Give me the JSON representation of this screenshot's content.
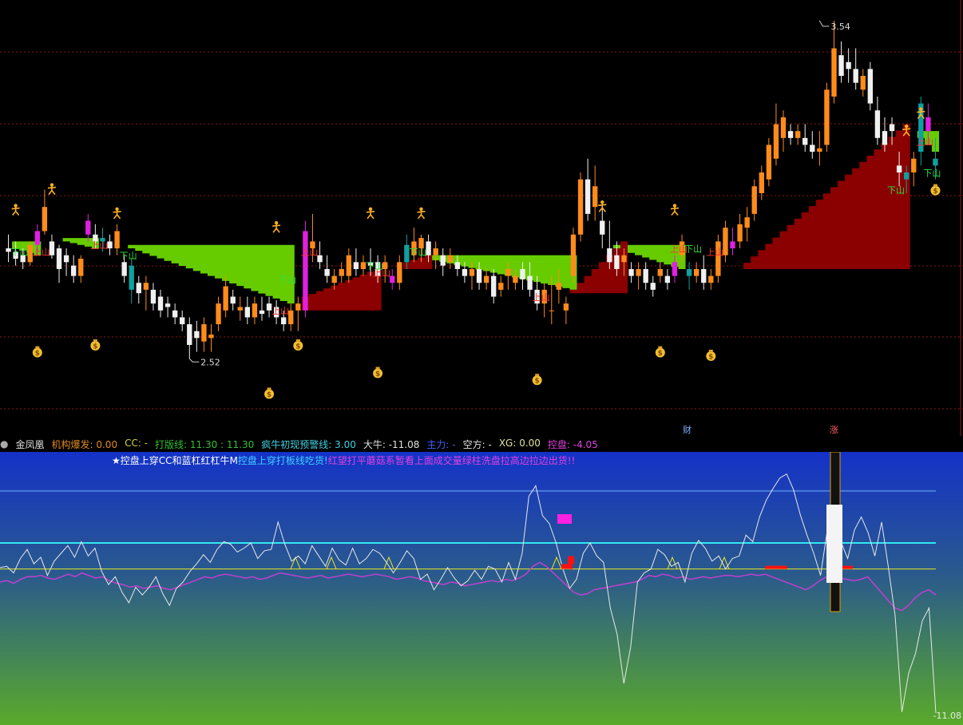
{
  "chart_data": [
    {
      "type": "candlestick",
      "panel": "main",
      "price_range": [
        2.35,
        3.6
      ],
      "annotations": {
        "high_label": "3.54",
        "low_label": "2.52"
      },
      "candles": [
        [
          2.88,
          2.92,
          2.84,
          2.87
        ],
        [
          2.87,
          2.9,
          2.83,
          2.85
        ],
        [
          2.86,
          2.88,
          2.82,
          2.84
        ],
        [
          2.84,
          2.9,
          2.83,
          2.89
        ],
        [
          2.89,
          2.95,
          2.86,
          2.93
        ],
        [
          2.93,
          3.05,
          2.92,
          3.0
        ],
        [
          2.9,
          2.92,
          2.85,
          2.86
        ],
        [
          2.88,
          2.89,
          2.78,
          2.82
        ],
        [
          2.86,
          2.88,
          2.8,
          2.84
        ],
        [
          2.83,
          2.86,
          2.78,
          2.8
        ],
        [
          2.8,
          2.86,
          2.78,
          2.85
        ],
        [
          2.92,
          2.98,
          2.9,
          2.96
        ],
        [
          2.92,
          2.95,
          2.88,
          2.9
        ],
        [
          2.9,
          2.94,
          2.87,
          2.91
        ],
        [
          2.9,
          2.92,
          2.86,
          2.88
        ],
        [
          2.88,
          2.95,
          2.86,
          2.93
        ],
        [
          2.84,
          2.86,
          2.78,
          2.8
        ],
        [
          2.83,
          2.85,
          2.72,
          2.76
        ],
        [
          2.78,
          2.8,
          2.72,
          2.75
        ],
        [
          2.76,
          2.8,
          2.7,
          2.78
        ],
        [
          2.76,
          2.78,
          2.7,
          2.72
        ],
        [
          2.74,
          2.76,
          2.68,
          2.7
        ],
        [
          2.72,
          2.74,
          2.68,
          2.71
        ],
        [
          2.7,
          2.72,
          2.66,
          2.68
        ],
        [
          2.68,
          2.7,
          2.64,
          2.66
        ],
        [
          2.66,
          2.68,
          2.56,
          2.6
        ],
        [
          2.64,
          2.67,
          2.58,
          2.62
        ],
        [
          2.61,
          2.68,
          2.58,
          2.66
        ],
        [
          2.62,
          2.66,
          2.58,
          2.63
        ],
        [
          2.66,
          2.74,
          2.64,
          2.72
        ],
        [
          2.7,
          2.8,
          2.68,
          2.77
        ],
        [
          2.74,
          2.76,
          2.7,
          2.72
        ],
        [
          2.7,
          2.74,
          2.67,
          2.71
        ],
        [
          2.71,
          2.74,
          2.66,
          2.68
        ],
        [
          2.68,
          2.74,
          2.66,
          2.72
        ],
        [
          2.7,
          2.74,
          2.67,
          2.69
        ],
        [
          2.72,
          2.74,
          2.68,
          2.7
        ],
        [
          2.71,
          2.73,
          2.66,
          2.68
        ],
        [
          2.68,
          2.7,
          2.64,
          2.66
        ],
        [
          2.66,
          2.72,
          2.64,
          2.7
        ],
        [
          2.7,
          2.74,
          2.64,
          2.72
        ],
        [
          2.7,
          2.96,
          2.68,
          2.93
        ],
        [
          2.88,
          2.98,
          2.84,
          2.9
        ],
        [
          2.86,
          2.9,
          2.82,
          2.84
        ],
        [
          2.82,
          2.86,
          2.78,
          2.8
        ],
        [
          2.78,
          2.82,
          2.76,
          2.8
        ],
        [
          2.8,
          2.84,
          2.78,
          2.82
        ],
        [
          2.8,
          2.88,
          2.78,
          2.86
        ],
        [
          2.84,
          2.88,
          2.8,
          2.82
        ],
        [
          2.82,
          2.86,
          2.8,
          2.84
        ],
        [
          2.84,
          2.88,
          2.8,
          2.83
        ],
        [
          2.84,
          2.86,
          2.78,
          2.8
        ],
        [
          2.82,
          2.86,
          2.78,
          2.84
        ],
        [
          2.8,
          2.82,
          2.76,
          2.78
        ],
        [
          2.78,
          2.86,
          2.76,
          2.84
        ],
        [
          2.84,
          2.92,
          2.82,
          2.89
        ],
        [
          2.86,
          2.94,
          2.84,
          2.9
        ],
        [
          2.88,
          2.92,
          2.84,
          2.91
        ],
        [
          2.9,
          2.92,
          2.84,
          2.86
        ],
        [
          2.86,
          2.9,
          2.82,
          2.88
        ],
        [
          2.86,
          2.88,
          2.8,
          2.83
        ],
        [
          2.84,
          2.88,
          2.82,
          2.86
        ],
        [
          2.84,
          2.86,
          2.8,
          2.82
        ],
        [
          2.82,
          2.84,
          2.78,
          2.8
        ],
        [
          2.8,
          2.84,
          2.76,
          2.82
        ],
        [
          2.82,
          2.84,
          2.76,
          2.78
        ],
        [
          2.78,
          2.82,
          2.76,
          2.8
        ],
        [
          2.8,
          2.82,
          2.72,
          2.74
        ],
        [
          2.76,
          2.8,
          2.74,
          2.78
        ],
        [
          2.8,
          2.84,
          2.76,
          2.82
        ],
        [
          2.78,
          2.82,
          2.76,
          2.8
        ],
        [
          2.82,
          2.84,
          2.76,
          2.79
        ],
        [
          2.8,
          2.84,
          2.74,
          2.76
        ],
        [
          2.76,
          2.8,
          2.7,
          2.72
        ],
        [
          2.72,
          2.78,
          2.68,
          2.76
        ],
        [
          2.7,
          2.8,
          2.66,
          2.7
        ],
        [
          2.76,
          2.82,
          2.72,
          2.78
        ],
        [
          2.7,
          2.74,
          2.66,
          2.72
        ],
        [
          2.8,
          2.94,
          2.78,
          2.92
        ],
        [
          2.92,
          3.1,
          2.9,
          3.08
        ],
        [
          3.08,
          3.14,
          2.96,
          2.98
        ],
        [
          3.0,
          3.12,
          2.96,
          3.06
        ],
        [
          2.96,
          3.0,
          2.88,
          2.92
        ],
        [
          2.88,
          2.96,
          2.82,
          2.84
        ],
        [
          2.86,
          2.9,
          2.8,
          2.82
        ],
        [
          2.84,
          2.88,
          2.8,
          2.86
        ],
        [
          2.82,
          2.84,
          2.78,
          2.8
        ],
        [
          2.8,
          2.84,
          2.76,
          2.82
        ],
        [
          2.82,
          2.84,
          2.76,
          2.78
        ],
        [
          2.78,
          2.8,
          2.74,
          2.76
        ],
        [
          2.8,
          2.84,
          2.78,
          2.82
        ],
        [
          2.8,
          2.82,
          2.76,
          2.78
        ],
        [
          2.8,
          2.86,
          2.78,
          2.84
        ],
        [
          2.86,
          2.92,
          2.84,
          2.9
        ],
        [
          2.82,
          2.84,
          2.76,
          2.8
        ],
        [
          2.8,
          2.84,
          2.78,
          2.82
        ],
        [
          2.82,
          2.86,
          2.76,
          2.78
        ],
        [
          2.78,
          2.82,
          2.76,
          2.8
        ],
        [
          2.8,
          2.92,
          2.78,
          2.9
        ],
        [
          2.86,
          2.96,
          2.84,
          2.94
        ],
        [
          2.88,
          2.94,
          2.86,
          2.9
        ],
        [
          2.9,
          2.98,
          2.88,
          2.95
        ],
        [
          2.94,
          3.0,
          2.9,
          2.97
        ],
        [
          2.98,
          3.08,
          2.96,
          3.06
        ],
        [
          3.04,
          3.12,
          3.02,
          3.1
        ],
        [
          3.08,
          3.2,
          3.06,
          3.18
        ],
        [
          3.14,
          3.3,
          3.12,
          3.24
        ],
        [
          3.2,
          3.28,
          3.16,
          3.26
        ],
        [
          3.22,
          3.24,
          3.18,
          3.2
        ],
        [
          3.2,
          3.24,
          3.18,
          3.22
        ],
        [
          3.2,
          3.24,
          3.16,
          3.18
        ],
        [
          3.18,
          3.22,
          3.14,
          3.16
        ],
        [
          3.16,
          3.22,
          3.12,
          3.17
        ],
        [
          3.18,
          3.36,
          3.16,
          3.34
        ],
        [
          3.32,
          3.54,
          3.3,
          3.46
        ],
        [
          3.44,
          3.48,
          3.36,
          3.38
        ],
        [
          3.42,
          3.46,
          3.36,
          3.4
        ],
        [
          3.4,
          3.46,
          3.34,
          3.36
        ],
        [
          3.34,
          3.4,
          3.32,
          3.38
        ],
        [
          3.4,
          3.42,
          3.28,
          3.3
        ],
        [
          3.28,
          3.32,
          3.18,
          3.2
        ],
        [
          3.22,
          3.26,
          3.16,
          3.18
        ],
        [
          3.24,
          3.26,
          3.18,
          3.22
        ],
        [
          3.12,
          3.16,
          3.06,
          3.1
        ],
        [
          3.08,
          3.12,
          3.04,
          3.1
        ],
        [
          3.1,
          3.16,
          3.06,
          3.14
        ],
        [
          3.16,
          3.32,
          3.12,
          3.3
        ],
        [
          3.22,
          3.3,
          3.18,
          3.26
        ],
        [
          3.14,
          3.2,
          3.08,
          3.12
        ]
      ]
    },
    {
      "type": "line",
      "panel": "indicator",
      "ylim": [
        -12,
        9
      ],
      "levels": [
        6,
        2,
        0
      ],
      "value_label": "-11.08",
      "series": [
        {
          "values": [
            0.1,
            0.2,
            -0.3,
            0.8,
            1.5,
            0.4,
            0.9,
            -0.5,
            0.6,
            1.2,
            1.8,
            0.9,
            2.1,
            1.0,
            1.6,
            -0.2,
            -1.2,
            -0.6,
            -1.8,
            -2.6,
            -1.4,
            -2.0,
            -1.4,
            -0.6,
            -1.9,
            -2.8,
            -1.5,
            -1.0,
            -0.2,
            0.4,
            1.1,
            0.5,
            1.5,
            2.1,
            1.9,
            1.3,
            1.6,
            2.0,
            0.8,
            1.4,
            1.5,
            3.6,
            1.9,
            0.6,
            1.0,
            0.4,
            1.8,
            1.0,
            0.2,
            1.6,
            0.7,
            0.3,
            1.6,
            0.4,
            0.8,
            1.5,
            1.2,
            0.5,
            -0.3,
            0.5,
            1.4,
            0.8,
            -0.8,
            -0.4,
            -1.6,
            -0.8,
            0.1,
            -0.7,
            -1.3,
            -0.9,
            -0.1,
            -0.8,
            0.2,
            0.0,
            -1.0,
            0.5,
            -0.8,
            1.2,
            5.6,
            6.4,
            4.1,
            3.5,
            2.0,
            0.0,
            -1.5,
            -0.8,
            1.2,
            2.0,
            1.0,
            0.5,
            -3.0,
            -5.0,
            -8.8,
            -6.0,
            -1.0,
            -0.3,
            0.0,
            1.5,
            1.1,
            0.2,
            0.5,
            -1.0,
            1.2,
            2.2,
            1.6,
            0.6,
            1.0,
            0.0,
            0.8,
            1.0,
            2.6,
            2.1,
            4.0,
            5.3,
            6.2,
            7.0,
            7.3,
            6.1,
            4.2,
            2.6,
            1.2,
            -0.5,
            3.0,
            3.7,
            2.1,
            0.8,
            3.0,
            4.0,
            2.8,
            1.0,
            3.6,
            0.1,
            -3.6,
            -11.0,
            -8.0,
            -6.5,
            -4.0,
            -3.0,
            -11.08
          ]
        },
        {
          "values": [
            -1.0,
            -0.9,
            -1.1,
            -0.8,
            -0.6,
            -0.6,
            -0.5,
            -0.7,
            -0.8,
            -0.6,
            -0.4,
            -0.6,
            -0.3,
            -0.5,
            -0.7,
            -0.6,
            -0.9,
            -1.1,
            -1.2,
            -1.4,
            -1.3,
            -1.5,
            -1.4,
            -1.3,
            -1.5,
            -1.6,
            -1.4,
            -1.2,
            -1.0,
            -0.8,
            -0.6,
            -0.7,
            -0.5,
            -0.4,
            -0.5,
            -0.6,
            -0.7,
            -0.6,
            -0.8,
            -0.7,
            -0.5,
            -0.3,
            -0.4,
            -0.5,
            -0.6,
            -0.7,
            -0.6,
            -0.5,
            -0.7,
            -0.6,
            -0.5,
            -0.4,
            -0.5,
            -0.6,
            -0.5,
            -0.4,
            -0.5,
            -0.6,
            -0.8,
            -0.7,
            -0.6,
            -0.7,
            -0.9,
            -1.0,
            -1.1,
            -1.2,
            -1.0,
            -1.1,
            -1.3,
            -1.2,
            -1.1,
            -1.0,
            -0.9,
            -1.0,
            -0.8,
            -0.9,
            -0.7,
            -0.4,
            0.2,
            0.5,
            0.2,
            -0.3,
            -0.8,
            -1.3,
            -1.8,
            -2.0,
            -1.9,
            -1.6,
            -1.5,
            -1.4,
            -1.3,
            -1.2,
            -1.1,
            -1.0,
            -0.8,
            -0.5,
            -0.6,
            -0.4,
            -0.5,
            -0.7,
            -0.6,
            -0.8,
            -0.7,
            -0.6,
            -0.7,
            -0.6,
            -0.5,
            -0.5,
            -0.6,
            -0.5,
            -0.4,
            -0.5,
            -0.4,
            -0.6,
            -0.8,
            -1.0,
            -1.2,
            -1.4,
            -1.6,
            -1.3,
            -0.9,
            -0.6,
            -0.8,
            -0.7,
            -0.8,
            -0.9,
            -0.8,
            -0.6,
            -1.2,
            -1.8,
            -2.4,
            -3.0,
            -3.2,
            -2.8,
            -2.2,
            -1.8,
            -1.6,
            -2.0
          ]
        }
      ]
    }
  ],
  "status": {
    "name": "金凤凰",
    "items": [
      {
        "label": "机构爆发:",
        "value": "0.00",
        "color": "#e08a20"
      },
      {
        "label": "CC:",
        "value": "-",
        "color": "#d0d040"
      },
      {
        "label": "打版线:",
        "value": "11.30",
        "value2": ": 11.30",
        "color": "#30c030"
      },
      {
        "label": "疯牛初现预警线:",
        "value": "3.00",
        "color": "#40d0e0"
      },
      {
        "label": "大牛:",
        "value": "-11.08",
        "color": "#e0e0e0"
      },
      {
        "label": "主力:",
        "value": "-",
        "color": "#4060ff"
      },
      {
        "label": "空方:",
        "value": "-",
        "color": "#e0e0e0"
      },
      {
        "label": "XG:",
        "value": "0.00",
        "color": "#e0e0a0"
      },
      {
        "label": "控盘:",
        "value": "-4.05",
        "color": "#e040e0"
      }
    ]
  },
  "signal_text": {
    "part1": "★控盘上穿CC和蓝杠红杠牛M",
    "part2": "控盘上穿打板线吃货!",
    "part3": "红望打平蘑菇系暂看上面成交量绿柱洗盘拉高边拉边出货!!"
  },
  "markers": {
    "cai": "财",
    "zhang": "涨",
    "up": "上山",
    "down": "下山"
  },
  "colors": {
    "up_candle": "#ff8c1a",
    "down_candle": "#f0f0f0",
    "magenta_candle": "#e020e0",
    "teal_candle": "#10a0a0",
    "green_fill": "#66cc00",
    "dark_red_fill": "#8b0000",
    "grid": "#8b1a1a"
  }
}
